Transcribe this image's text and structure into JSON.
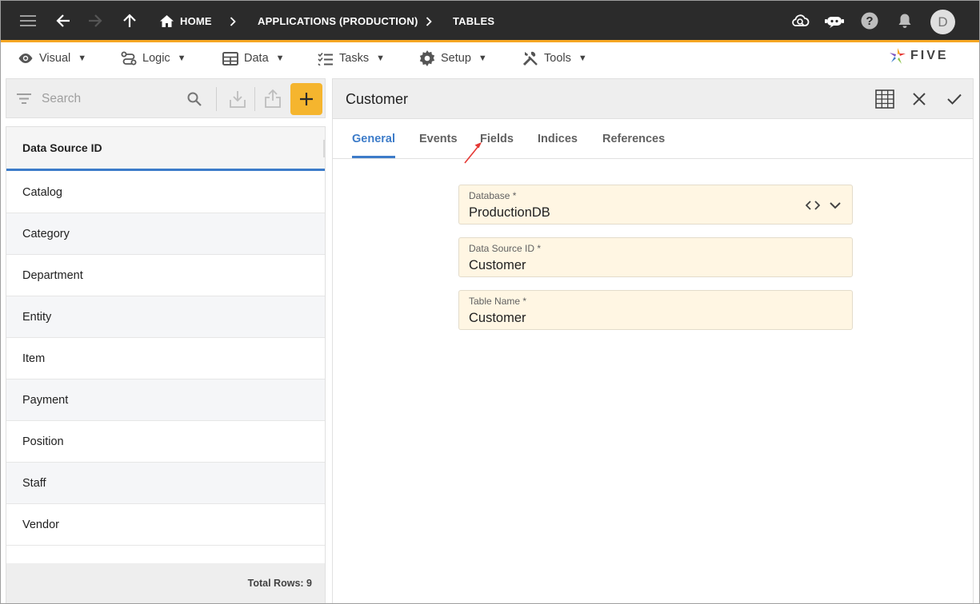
{
  "appbar": {
    "breadcrumbs": [
      "HOME",
      "APPLICATIONS (PRODUCTION)",
      "TABLES"
    ],
    "avatar_initial": "D",
    "icons": [
      "menu-icon",
      "back-arrow-icon",
      "forward-arrow-icon",
      "up-arrow-icon",
      "home-icon",
      "cloud-sync-icon",
      "chat-bot-icon",
      "help-icon",
      "notification-bell-icon"
    ]
  },
  "menubar": {
    "items": [
      {
        "label": "Visual",
        "icon": "eye-icon"
      },
      {
        "label": "Logic",
        "icon": "logic-flow-icon"
      },
      {
        "label": "Data",
        "icon": "table-grid-icon"
      },
      {
        "label": "Tasks",
        "icon": "checklist-icon"
      },
      {
        "label": "Setup",
        "icon": "gear-icon"
      },
      {
        "label": "Tools",
        "icon": "tools-icon"
      }
    ],
    "caret": "▼",
    "logo_text": "FIVE"
  },
  "left_panel": {
    "search_placeholder": "Search",
    "column_header": "Data Source ID",
    "rows": [
      "Catalog",
      "Category",
      "Department",
      "Entity",
      "Item",
      "Payment",
      "Position",
      "Staff",
      "Vendor"
    ],
    "footer": "Total Rows: 9"
  },
  "form": {
    "title": "Customer",
    "tabs": [
      {
        "label": "General",
        "active": true
      },
      {
        "label": "Events",
        "active": false
      },
      {
        "label": "Fields",
        "active": false
      },
      {
        "label": "Indices",
        "active": false
      },
      {
        "label": "References",
        "active": false
      }
    ],
    "fields": [
      {
        "label": "Database *",
        "value": "ProductionDB"
      },
      {
        "label": "Data Source ID *",
        "value": "Customer"
      },
      {
        "label": "Table Name *",
        "value": "Customer"
      }
    ]
  },
  "colors": {
    "appbar_bg": "#2b2b2b",
    "accent_orange": "#f5a623",
    "add_button": "#f5b52e",
    "active_tab": "#3d7cc9",
    "field_bg": "#fff6e3",
    "annotation_arrow": "#e53935"
  }
}
